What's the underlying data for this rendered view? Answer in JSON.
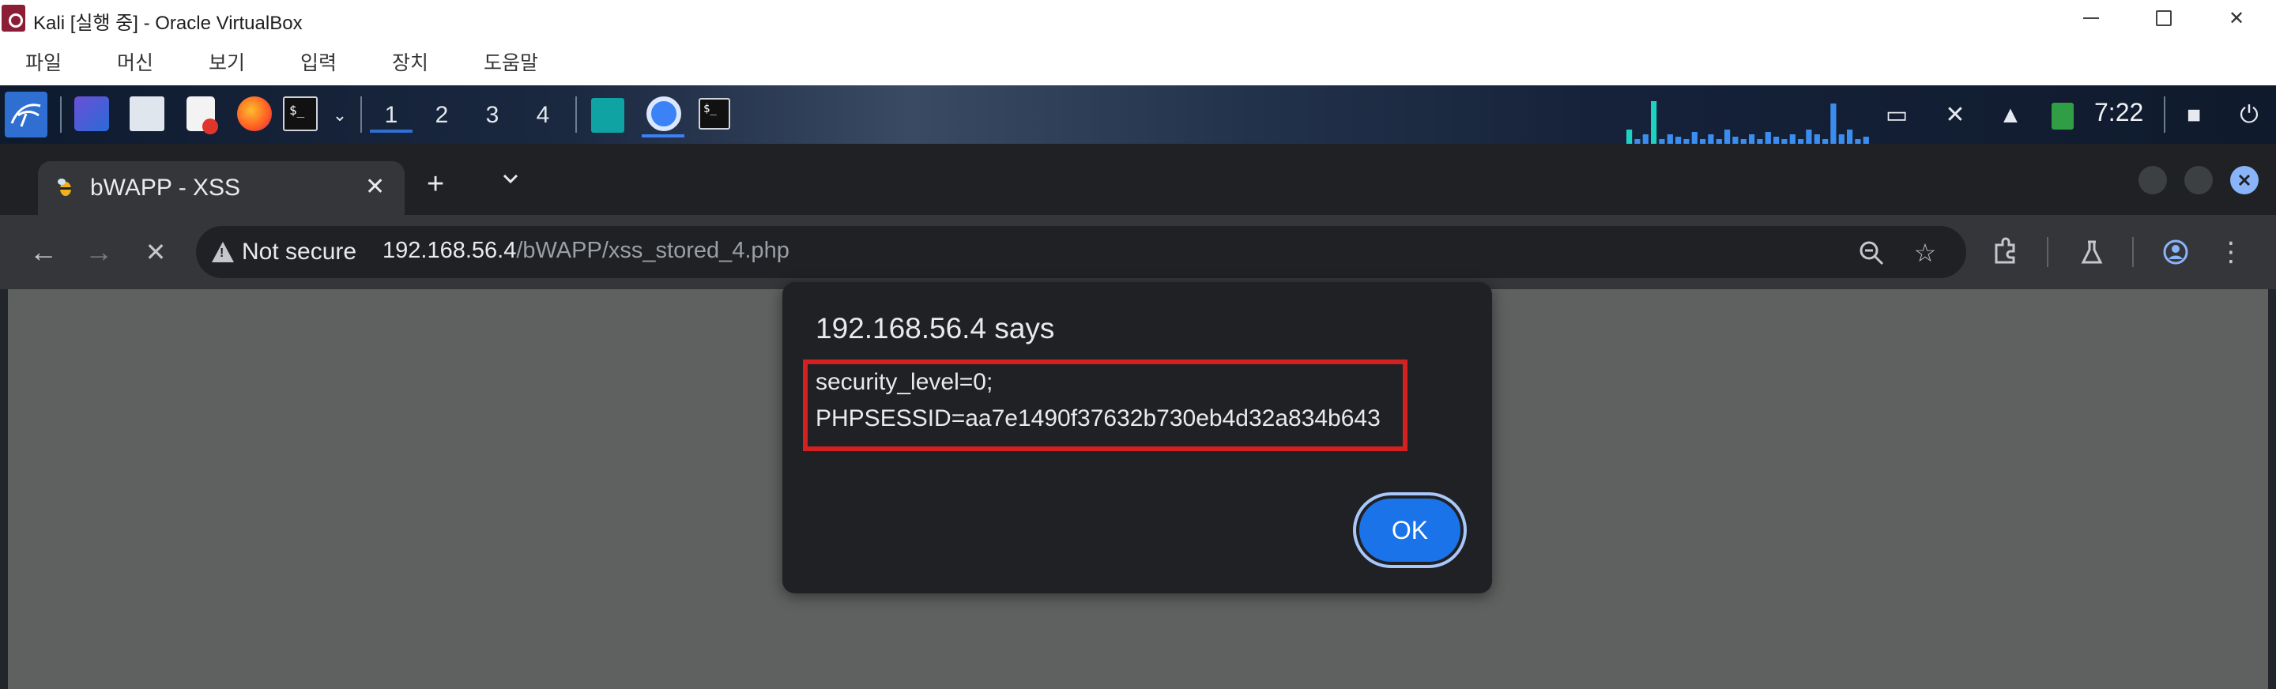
{
  "host": {
    "title": "Kali [실행 중] - Oracle VirtualBox",
    "menu": [
      "파일",
      "머신",
      "보기",
      "입력",
      "장치",
      "도움말"
    ]
  },
  "panel": {
    "workspaces": [
      "1",
      "2",
      "3",
      "4"
    ],
    "active_workspace": 0,
    "clock": "7:22",
    "launchers": [
      "kali-menu-icon",
      "desktop-icon",
      "file-manager-icon",
      "text-editor-icon",
      "firefox-icon",
      "terminal-icon",
      "dropdown-icon"
    ],
    "tray": [
      "display-icon",
      "mute-icon",
      "bell-icon",
      "battery-icon",
      "lock-icon",
      "logout-icon"
    ],
    "cpu_levels": [
      0.3,
      0.1,
      0.2,
      0.9,
      0.1,
      0.2,
      0.15,
      0.1,
      0.25,
      0.1,
      0.2,
      0.1,
      0.3,
      0.15,
      0.1,
      0.2,
      0.1,
      0.25,
      0.15,
      0.1,
      0.2,
      0.1,
      0.3,
      0.2,
      0.1,
      0.85,
      0.2,
      0.3,
      0.1,
      0.15
    ],
    "accent_color": "#2f6fd1"
  },
  "browser": {
    "tab_title": "bWAPP - XSS",
    "new_tab": "+",
    "security_label": "Not secure",
    "url_host": "192.168.56.4",
    "url_path": "/bWAPP/xss_stored_4.php"
  },
  "dialog": {
    "title": "192.168.56.4 says",
    "line1": "security_level=0;",
    "line2": "PHPSESSID=aa7e1490f37632b730eb4d32a834b643",
    "ok": "OK",
    "highlight_color": "#d32020",
    "button_color": "#1a73e8"
  }
}
